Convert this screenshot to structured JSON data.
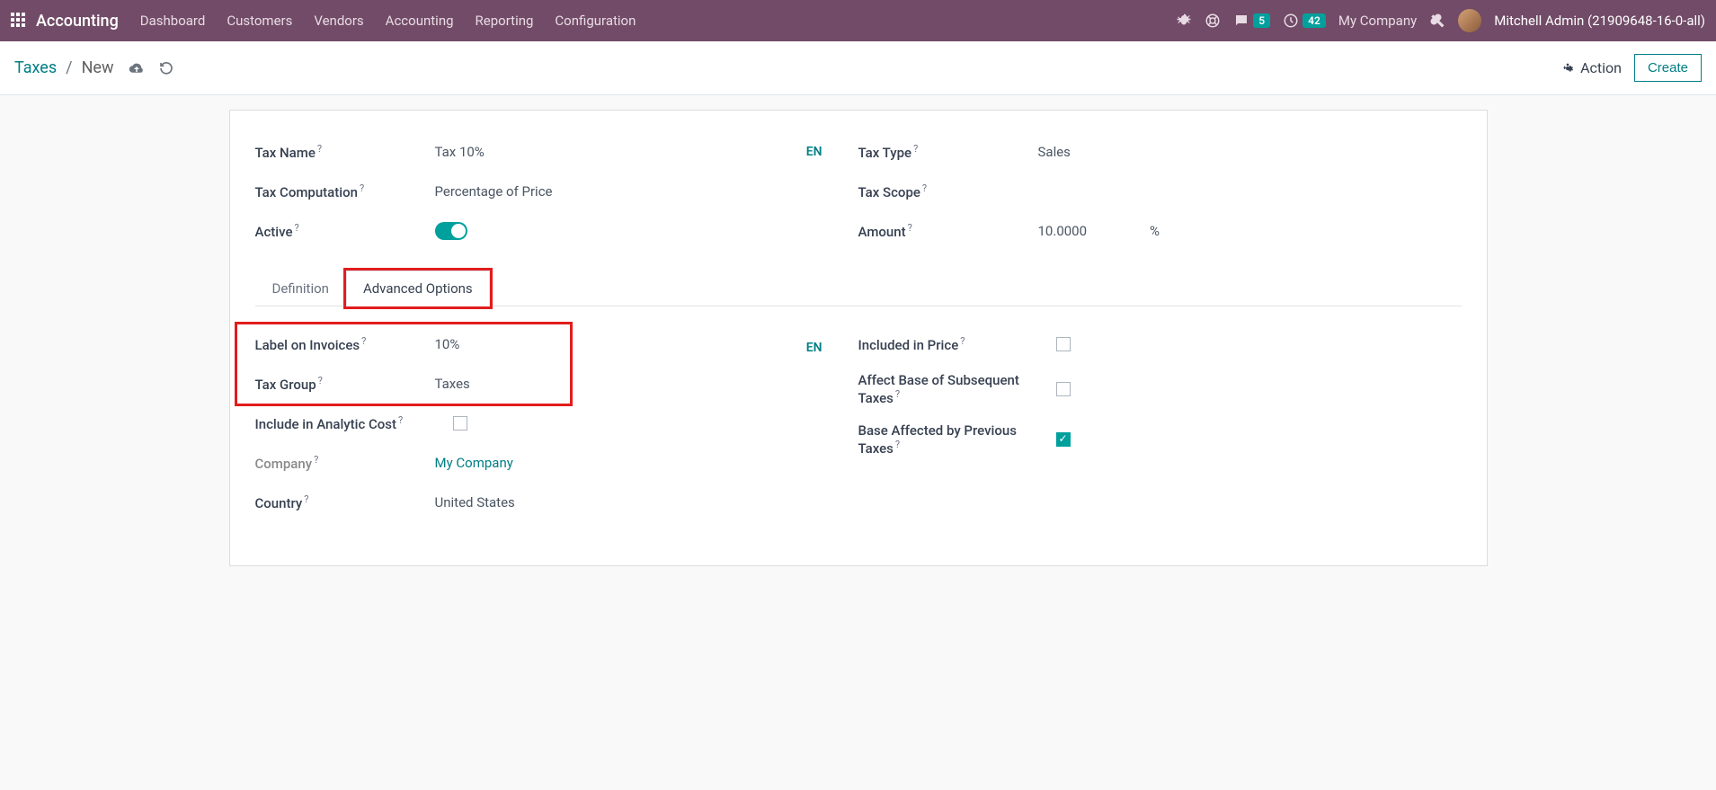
{
  "topbar": {
    "brand": "Accounting",
    "menu": [
      "Dashboard",
      "Customers",
      "Vendors",
      "Accounting",
      "Reporting",
      "Configuration"
    ],
    "msg_count": "5",
    "clock_count": "42",
    "company": "My Company",
    "user": "Mitchell Admin (21909648-16-0-all)"
  },
  "control": {
    "crumb_root": "Taxes",
    "crumb_current": "New",
    "action_label": "Action",
    "create_label": "Create"
  },
  "form": {
    "left": {
      "tax_name_label": "Tax Name",
      "tax_name_value": "Tax 10%",
      "computation_label": "Tax Computation",
      "computation_value": "Percentage of Price",
      "active_label": "Active",
      "lang": "EN"
    },
    "right": {
      "tax_type_label": "Tax Type",
      "tax_type_value": "Sales",
      "tax_scope_label": "Tax Scope",
      "tax_scope_value": "",
      "amount_label": "Amount",
      "amount_value": "10.0000",
      "amount_unit": "%"
    },
    "tabs": [
      "Definition",
      "Advanced Options"
    ],
    "adv": {
      "left": {
        "label_invoices_label": "Label on Invoices",
        "label_invoices_value": "10%",
        "tax_group_label": "Tax Group",
        "tax_group_value": "Taxes",
        "include_analytic_label": "Include in Analytic Cost",
        "company_label": "Company",
        "company_value": "My Company",
        "country_label": "Country",
        "country_value": "United States",
        "lang": "EN"
      },
      "right": {
        "included_price_label": "Included in Price",
        "affect_base_label": "Affect Base of Subsequent Taxes",
        "base_affected_label": "Base Affected by Previous Taxes"
      }
    }
  }
}
